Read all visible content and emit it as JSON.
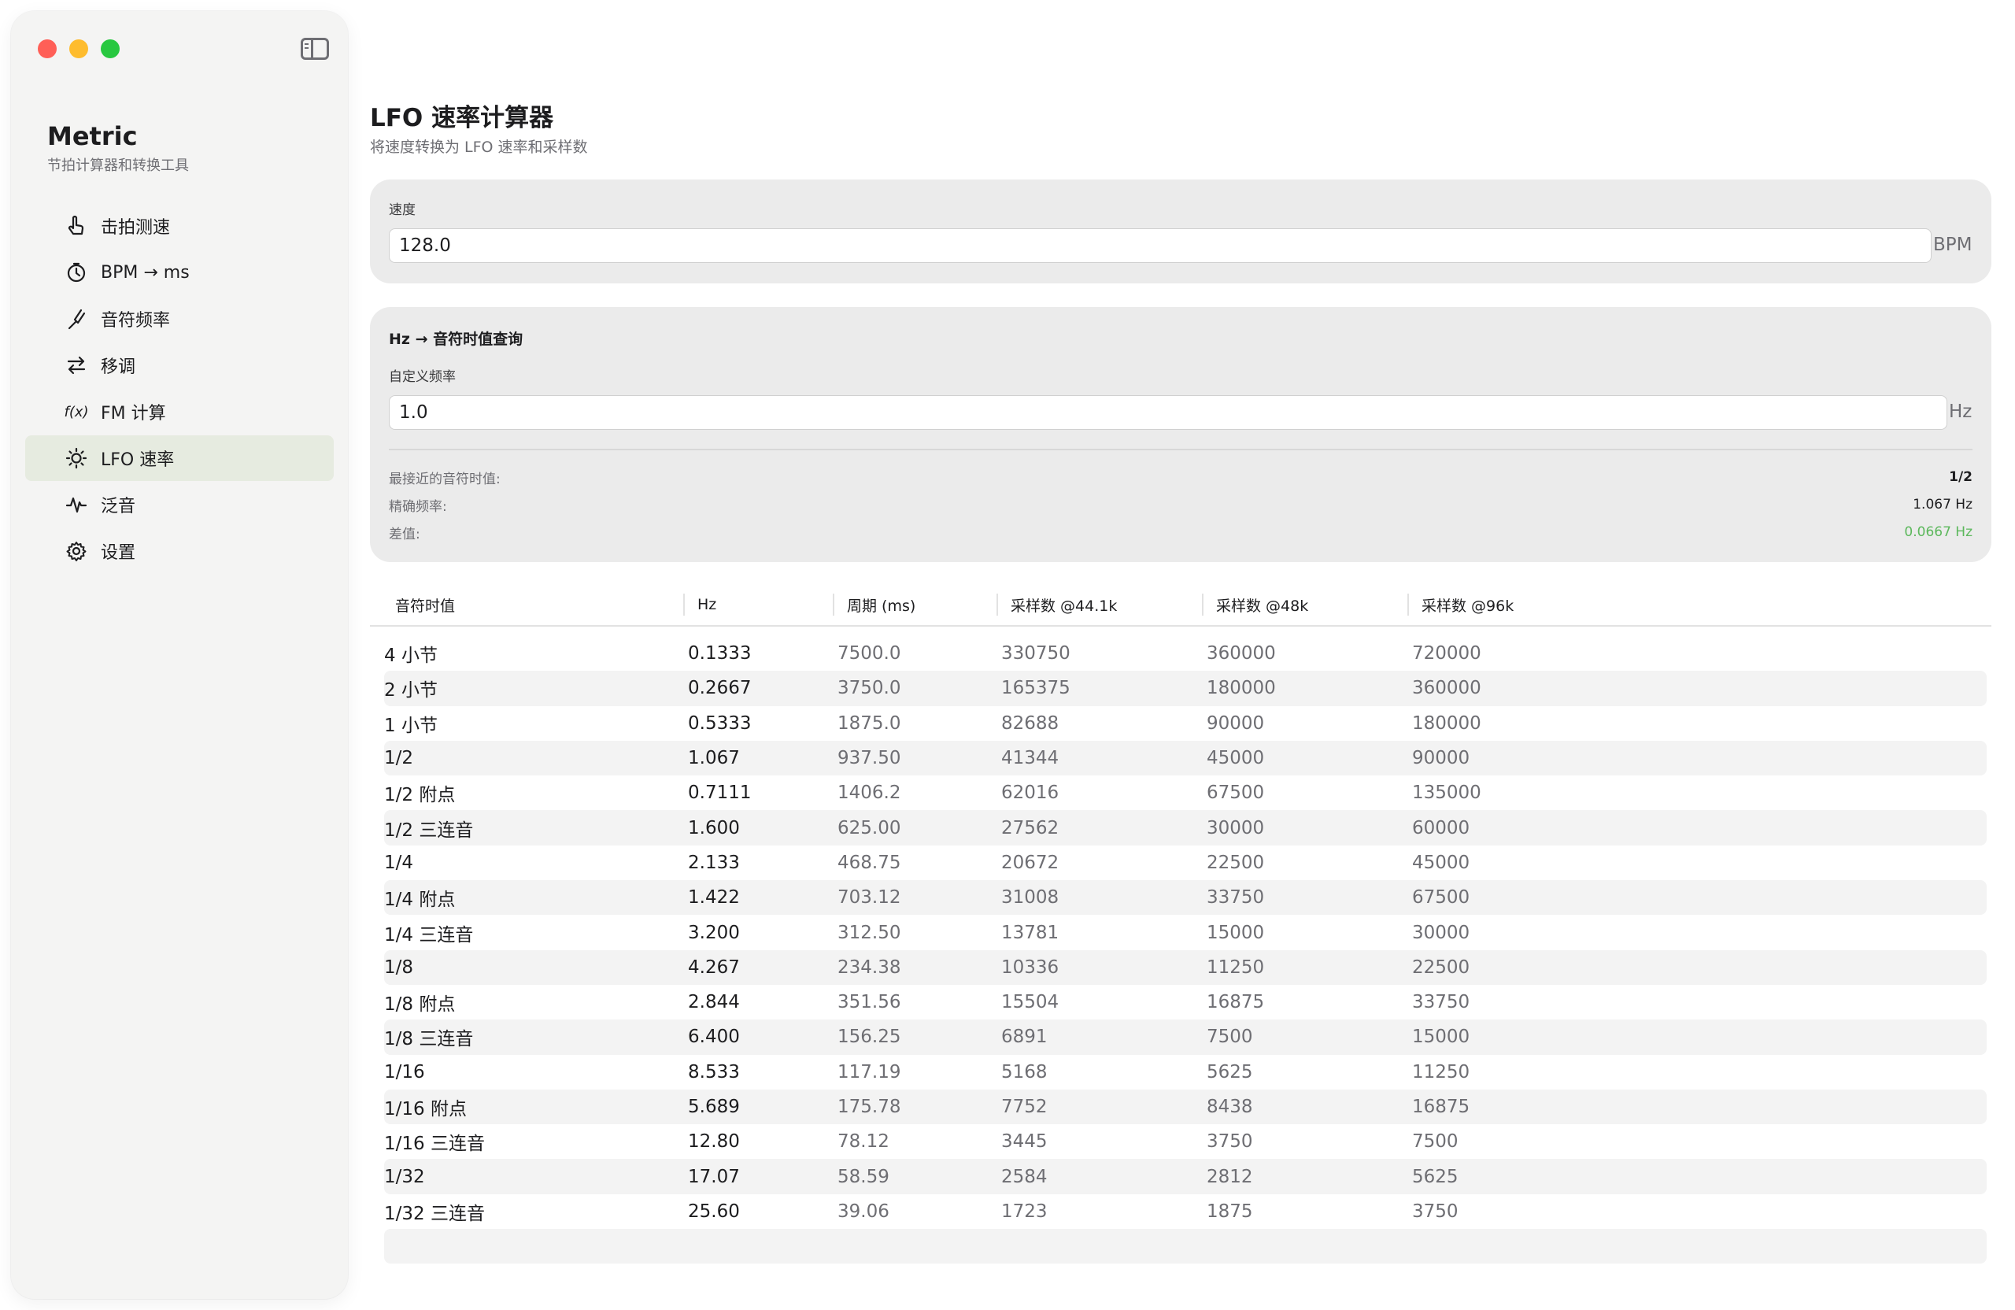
{
  "sidebar": {
    "app_title": "Metric",
    "app_subtitle": "节拍计算器和转换工具",
    "items": [
      {
        "label": "击拍测速",
        "icon": "tap-hand-icon"
      },
      {
        "label": "BPM → ms",
        "icon": "timer-icon"
      },
      {
        "label": "音符频率",
        "icon": "tuning-fork-icon"
      },
      {
        "label": "移调",
        "icon": "transpose-arrows-icon"
      },
      {
        "label": "FM 计算",
        "icon": "function-icon"
      },
      {
        "label": "LFO 速率",
        "icon": "lfo-sun-icon",
        "active": true
      },
      {
        "label": "泛音",
        "icon": "waveform-icon"
      },
      {
        "label": "设置",
        "icon": "gear-icon"
      }
    ]
  },
  "page": {
    "title": "LFO 速率计算器",
    "subtitle": "将速度转换为 LFO 速率和采样数"
  },
  "speed": {
    "label": "速度",
    "value": "128.0",
    "unit": "BPM"
  },
  "lookup": {
    "title": "Hz → 音符时值查询",
    "field_label": "自定义频率",
    "value": "1.0",
    "unit": "Hz",
    "nearest_label": "最接近的音符时值:",
    "nearest_value": "1/2",
    "exact_label": "精确频率:",
    "exact_value": "1.067 Hz",
    "diff_label": "差值:",
    "diff_value": "0.0667 Hz"
  },
  "table": {
    "headers": [
      "音符时值",
      "Hz",
      "周期 (ms)",
      "采样数 @44.1k",
      "采样数 @48k",
      "采样数 @96k"
    ],
    "rows": [
      [
        "4 小节",
        "0.1333",
        "7500.0",
        "330750",
        "360000",
        "720000"
      ],
      [
        "2 小节",
        "0.2667",
        "3750.0",
        "165375",
        "180000",
        "360000"
      ],
      [
        "1 小节",
        "0.5333",
        "1875.0",
        "82688",
        "90000",
        "180000"
      ],
      [
        "1/2",
        "1.067",
        "937.50",
        "41344",
        "45000",
        "90000"
      ],
      [
        "1/2 附点",
        "0.7111",
        "1406.2",
        "62016",
        "67500",
        "135000"
      ],
      [
        "1/2 三连音",
        "1.600",
        "625.00",
        "27562",
        "30000",
        "60000"
      ],
      [
        "1/4",
        "2.133",
        "468.75",
        "20672",
        "22500",
        "45000"
      ],
      [
        "1/4 附点",
        "1.422",
        "703.12",
        "31008",
        "33750",
        "67500"
      ],
      [
        "1/4 三连音",
        "3.200",
        "312.50",
        "13781",
        "15000",
        "30000"
      ],
      [
        "1/8",
        "4.267",
        "234.38",
        "10336",
        "11250",
        "22500"
      ],
      [
        "1/8 附点",
        "2.844",
        "351.56",
        "15504",
        "16875",
        "33750"
      ],
      [
        "1/8 三连音",
        "6.400",
        "156.25",
        "6891",
        "7500",
        "15000"
      ],
      [
        "1/16",
        "8.533",
        "117.19",
        "5168",
        "5625",
        "11250"
      ],
      [
        "1/16 附点",
        "5.689",
        "175.78",
        "7752",
        "8438",
        "16875"
      ],
      [
        "1/16 三连音",
        "12.80",
        "78.12",
        "3445",
        "3750",
        "7500"
      ],
      [
        "1/32",
        "17.07",
        "58.59",
        "2584",
        "2812",
        "5625"
      ],
      [
        "1/32 三连音",
        "25.60",
        "39.06",
        "1723",
        "1875",
        "3750"
      ]
    ]
  },
  "colors": {
    "accent_active": "#e6ebe0",
    "diff_green": "#5cb85c",
    "traffic_red": "#ff5f57",
    "traffic_yellow": "#febc2e",
    "traffic_green": "#28c840"
  }
}
